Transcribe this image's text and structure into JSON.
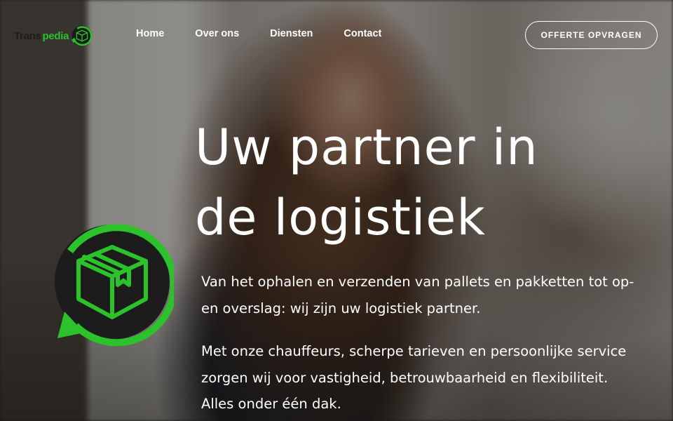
{
  "brand": {
    "name_part1": "Trans",
    "name_part2": "pedia",
    "logo_icon": "box-cycle-icon",
    "accent_color": "#2bc22b"
  },
  "nav": {
    "items": [
      {
        "label": "Home"
      },
      {
        "label": "Over ons"
      },
      {
        "label": "Diensten"
      },
      {
        "label": "Contact"
      }
    ],
    "cta_label": "OFFERTE OPVRAGEN"
  },
  "hero": {
    "headline_line1": "Uw partner in",
    "headline_line2": "de logistiek",
    "paragraph1": "Van het ophalen en verzenden van pallets en pakketten tot op- en overslag: wij zijn uw logistiek partner.",
    "paragraph2": "Met onze chauffeurs, scherpe tarieven en persoonlijke service zorgen wij voor vastigheid, betrouwbaarheid en flexibiliteit. Alles onder één dak.",
    "icon": "box-cycle-icon"
  }
}
